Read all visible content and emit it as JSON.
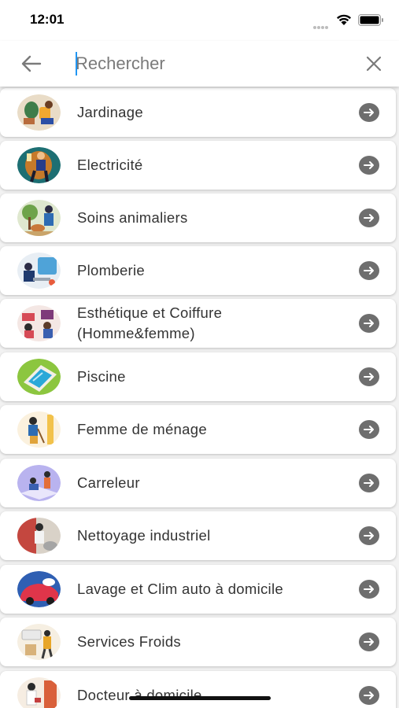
{
  "status_bar": {
    "time": "12:01"
  },
  "search": {
    "placeholder": "Rechercher",
    "value": ""
  },
  "colors": {
    "accent": "#2196f3",
    "arrow": "#6e6e6e"
  },
  "services": [
    {
      "label": "Jardinage",
      "icon": "gardening-icon"
    },
    {
      "label": "Electricité",
      "icon": "electrician-icon"
    },
    {
      "label": "Soins animaliers",
      "icon": "animal-care-icon"
    },
    {
      "label": "Plomberie",
      "icon": "plumbing-icon"
    },
    {
      "label": "Esthétique et Coiffure (Homme&femme)",
      "icon": "beauty-hair-icon"
    },
    {
      "label": "Piscine",
      "icon": "pool-icon"
    },
    {
      "label": "Femme de ménage",
      "icon": "housekeeper-icon"
    },
    {
      "label": "Carreleur",
      "icon": "tiler-icon"
    },
    {
      "label": "Nettoyage industriel",
      "icon": "industrial-cleaning-icon"
    },
    {
      "label": "Lavage et Clim auto à domicile",
      "icon": "car-wash-icon"
    },
    {
      "label": "Services Froids",
      "icon": "cold-services-icon"
    },
    {
      "label": "Docteur à domicile",
      "icon": "home-doctor-icon"
    }
  ]
}
